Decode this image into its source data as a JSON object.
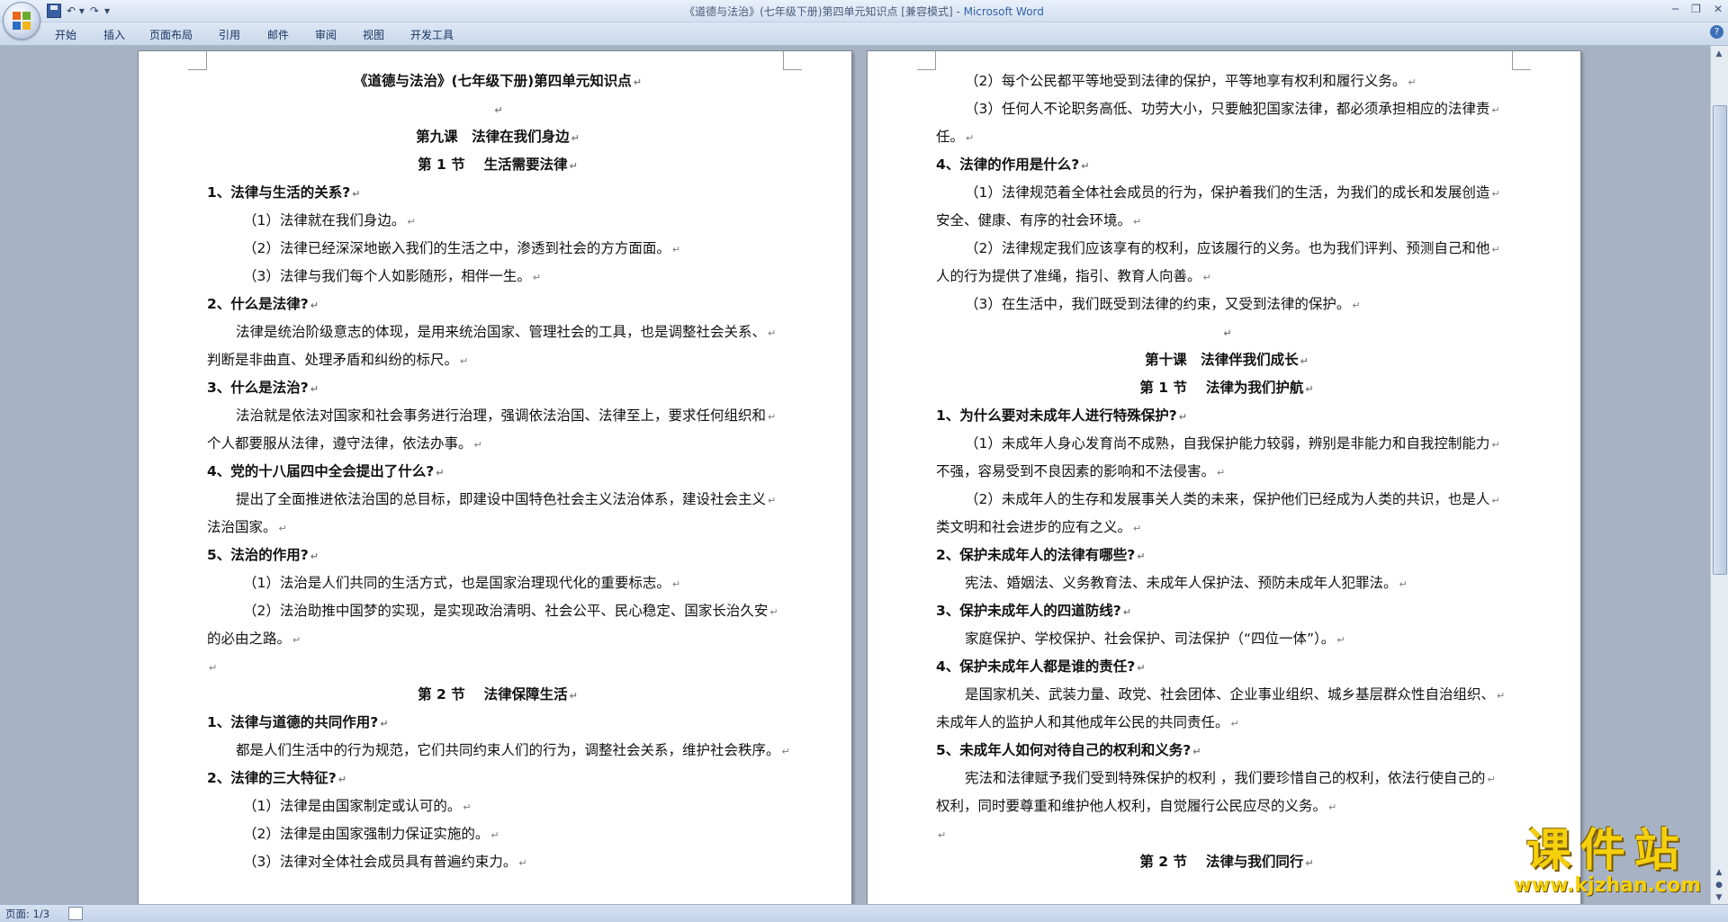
{
  "window": {
    "title_doc": "《道德与法治》(七年级下册)第四单元知识点 [兼容模式] - ",
    "title_app": "Microsoft Word"
  },
  "ribbon": {
    "tabs": [
      "开始",
      "插入",
      "页面布局",
      "引用",
      "邮件",
      "审阅",
      "视图",
      "开发工具"
    ]
  },
  "document": {
    "page1_lines": [
      {
        "t": "《道德与法治》(七年级下册)第四单元知识点",
        "s": "c"
      },
      {
        "t": "",
        "s": "c"
      },
      {
        "t": "第九课　法律在我们身边",
        "s": "c"
      },
      {
        "t": "第 1 节　 生活需要法律",
        "s": "c"
      },
      {
        "t": "1、法律与生活的关系?",
        "s": "h"
      },
      {
        "t": "（1）法律就在我们身边。",
        "s": "i2"
      },
      {
        "t": "（2）法律已经深深地嵌入我们的生活之中，渗透到社会的方方面面。",
        "s": "i2"
      },
      {
        "t": "（3）法律与我们每个人如影随形，相伴一生。",
        "s": "i2"
      },
      {
        "t": "2、什么是法律?",
        "s": "h"
      },
      {
        "t": "法律是统治阶级意志的体现，是用来统治国家、管理社会的工具，也是调整社会关系、",
        "s": "i1"
      },
      {
        "t": "判断是非曲直、处理矛盾和纠纷的标尺。",
        "s": ""
      },
      {
        "t": "3、什么是法治?",
        "s": "h"
      },
      {
        "t": "法治就是依法对国家和社会事务进行治理，强调依法治国、法律至上，要求任何组织和",
        "s": "i1"
      },
      {
        "t": "个人都要服从法律，遵守法律，依法办事。",
        "s": ""
      },
      {
        "t": "4、党的十八届四中全会提出了什么?",
        "s": "h"
      },
      {
        "t": "提出了全面推进依法治国的总目标，即建设中国特色社会主义法治体系，建设社会主义",
        "s": "i1"
      },
      {
        "t": "法治国家。",
        "s": ""
      },
      {
        "t": "5、法治的作用?",
        "s": "h"
      },
      {
        "t": "（1）法治是人们共同的生活方式，也是国家治理现代化的重要标志。",
        "s": "i2"
      },
      {
        "t": "（2）法治助推中国梦的实现，是实现政治清明、社会公平、民心稳定、国家长治久安",
        "s": "i2"
      },
      {
        "t": "的必由之路。",
        "s": ""
      },
      {
        "t": "",
        "s": ""
      },
      {
        "t": "第 2 节　 法律保障生活",
        "s": "c"
      },
      {
        "t": "1、法律与道德的共同作用?",
        "s": "h"
      },
      {
        "t": "都是人们生活中的行为规范，它们共同约束人们的行为，调整社会关系，维护社会秩序。",
        "s": "i1"
      },
      {
        "t": "2、法律的三大特征?",
        "s": "h"
      },
      {
        "t": "（1）法律是由国家制定或认可的。",
        "s": "i2"
      },
      {
        "t": "（2）法律是由国家强制力保证实施的。",
        "s": "i2"
      },
      {
        "t": "（3）法律对全体社会成员具有普遍约束力。",
        "s": "i2"
      }
    ],
    "page2_lines": [
      {
        "t": "（2）每个公民都平等地受到法律的保护，平等地享有权利和履行义务。",
        "s": "i1"
      },
      {
        "t": "（3）任何人不论职务高低、功劳大小，只要触犯国家法律，都必须承担相应的法律责",
        "s": "i1"
      },
      {
        "t": "任。",
        "s": ""
      },
      {
        "t": "4、法律的作用是什么?",
        "s": "h"
      },
      {
        "t": "（1）法律规范着全体社会成员的行为，保护着我们的生活，为我们的成长和发展创造",
        "s": "i1"
      },
      {
        "t": "安全、健康、有序的社会环境。",
        "s": ""
      },
      {
        "t": "（2）法律规定我们应该享有的权利，应该履行的义务。也为我们评判、预测自己和他",
        "s": "i1"
      },
      {
        "t": "人的行为提供了准绳，指引、教育人向善。",
        "s": ""
      },
      {
        "t": "（3）在生活中，我们既受到法律的约束，又受到法律的保护。",
        "s": "i1"
      },
      {
        "t": "",
        "s": "c"
      },
      {
        "t": "第十课　法律伴我们成长",
        "s": "c"
      },
      {
        "t": "第 1 节　 法律为我们护航",
        "s": "c"
      },
      {
        "t": "1、为什么要对未成年人进行特殊保护?",
        "s": "h"
      },
      {
        "t": "（1）未成年人身心发育尚不成熟，自我保护能力较弱，辨别是非能力和自我控制能力",
        "s": "i1"
      },
      {
        "t": "不强，容易受到不良因素的影响和不法侵害。",
        "s": ""
      },
      {
        "t": "（2）未成年人的生存和发展事关人类的未来，保护他们已经成为人类的共识，也是人",
        "s": "i1"
      },
      {
        "t": "类文明和社会进步的应有之义。",
        "s": ""
      },
      {
        "t": "2、保护未成年人的法律有哪些?",
        "s": "h"
      },
      {
        "t": "宪法、婚姻法、义务教育法、未成年人保护法、预防未成年人犯罪法。",
        "s": "i1"
      },
      {
        "t": "3、保护未成年人的四道防线?",
        "s": "h"
      },
      {
        "t": "家庭保护、学校保护、社会保护、司法保护（“四位一体”）。",
        "s": "i1"
      },
      {
        "t": "4、保护未成年人都是谁的责任?",
        "s": "h"
      },
      {
        "t": "是国家机关、武装力量、政党、社会团体、企业事业组织、城乡基层群众性自治组织、",
        "s": "i1"
      },
      {
        "t": "未成年人的监护人和其他成年公民的共同责任。",
        "s": ""
      },
      {
        "t": "5、未成年人如何对待自己的权利和义务?",
        "s": "h"
      },
      {
        "t": "宪法和法律赋予我们受到特殊保护的权利 ，我们要珍惜自己的权利，依法行使自己的",
        "s": "i1"
      },
      {
        "t": "权利，同时要尊重和维护他人权利，自觉履行公民应尽的义务。",
        "s": ""
      },
      {
        "t": "",
        "s": ""
      },
      {
        "t": "第 2 节　 法律与我们同行",
        "s": "c"
      }
    ]
  },
  "statusbar": {
    "page": "页面: 1/3"
  },
  "watermark": {
    "title": "课件站",
    "url": "www.kjzhan.com"
  }
}
